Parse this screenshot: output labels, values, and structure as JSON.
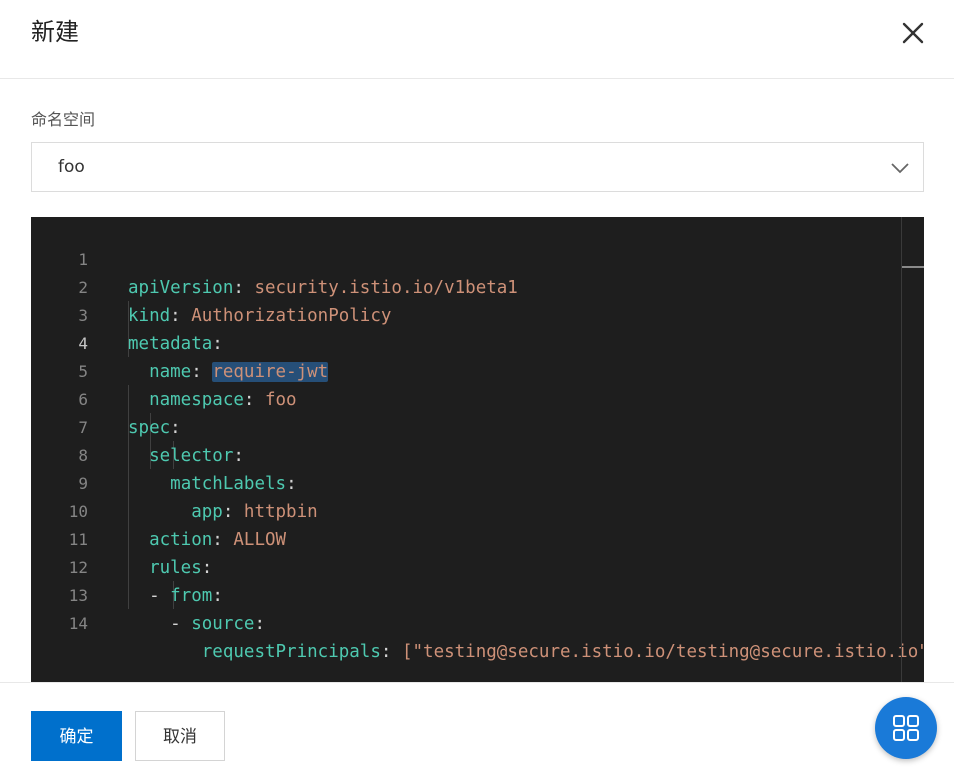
{
  "dialog": {
    "title": "新建",
    "close_icon": "close-icon"
  },
  "namespace": {
    "label": "命名空间",
    "value": "foo",
    "dropdown_icon": "chevron-down-icon"
  },
  "editor": {
    "active_line": 4,
    "selected_text": "require-jwt",
    "colors": {
      "background": "#1e1e1e",
      "key": "#4ec9b0",
      "value": "#ce9178",
      "selection": "#264f78"
    },
    "lines": [
      {
        "n": "1",
        "key": "apiVersion",
        "sep": ": ",
        "val": "security.istio.io/v1beta1"
      },
      {
        "n": "2",
        "key": "kind",
        "sep": ": ",
        "val": "AuthorizationPolicy"
      },
      {
        "n": "3",
        "key": "metadata",
        "sep": ":",
        "val": ""
      },
      {
        "n": "4",
        "key": "name",
        "sep": ": ",
        "val": "require-jwt"
      },
      {
        "n": "5",
        "key": "namespace",
        "sep": ": ",
        "val": "foo"
      },
      {
        "n": "6",
        "key": "spec",
        "sep": ":",
        "val": ""
      },
      {
        "n": "7",
        "key": "selector",
        "sep": ":",
        "val": ""
      },
      {
        "n": "8",
        "key": "matchLabels",
        "sep": ":",
        "val": ""
      },
      {
        "n": "9",
        "key": "app",
        "sep": ": ",
        "val": "httpbin"
      },
      {
        "n": "10",
        "key": "action",
        "sep": ": ",
        "val": "ALLOW"
      },
      {
        "n": "11",
        "key": "rules",
        "sep": ":",
        "val": ""
      },
      {
        "n": "12",
        "dash": "- ",
        "key": "from",
        "sep": ":",
        "val": ""
      },
      {
        "n": "13",
        "dash": "- ",
        "key": "source",
        "sep": ":",
        "val": ""
      },
      {
        "n": "14",
        "key": "requestPrincipals",
        "sep": ": ",
        "val": "[\"testing@secure.istio.io/testing@secure.istio.io\"]"
      }
    ]
  },
  "footer": {
    "ok_label": "确定",
    "cancel_label": "取消",
    "fab_icon": "grid-icon"
  }
}
